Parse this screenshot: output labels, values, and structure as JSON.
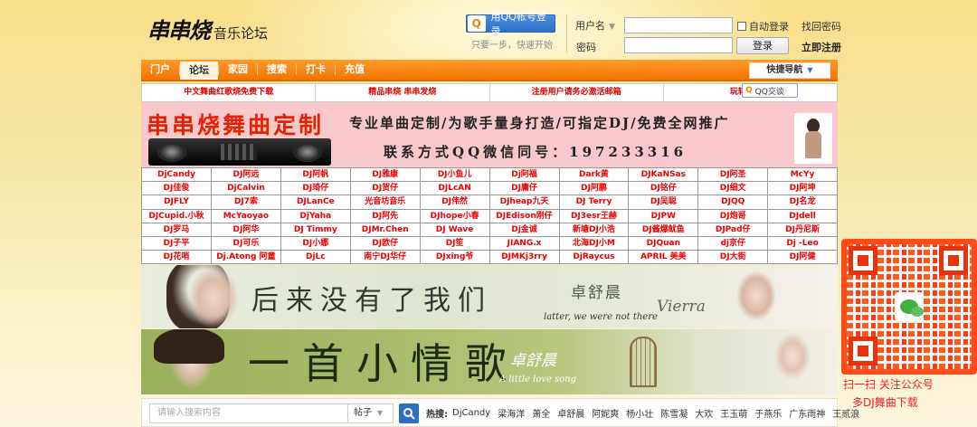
{
  "header": {
    "logo_main": "串串烧",
    "logo_sub": "音乐论坛",
    "qq_login_label": "用QQ帐号登录",
    "qq_hint": "只要一步，快速开始",
    "username_label": "用户名",
    "password_label": "密码",
    "auto_login_label": "自动登录",
    "find_password": "找回密码",
    "login_button": "登录",
    "register": "立即注册"
  },
  "nav": {
    "items": [
      "门户",
      "论坛",
      "家园",
      "搜索",
      "打卡",
      "充值"
    ],
    "active_index": 1,
    "quick_nav": "快捷导航"
  },
  "announcements": [
    "中文舞曲红歌烧免费下载",
    "精品串烧 串串发烧",
    "注册用户请务必激活邮箱",
    "玩转串串烧"
  ],
  "qq_chat": "QQ交谈",
  "banner": {
    "title": "串串烧舞曲定制",
    "line1": "专业单曲定制/为歌手量身打造/可指定DJ/免费全网推广",
    "line2": "联系方式QQ微信同号：197233316"
  },
  "dj_rows": [
    [
      "DjCandy",
      "DJ阿远",
      "DJ阿帆",
      "DJ雅康",
      "DJ小鱼儿",
      "Dj阿福",
      "Dark黄",
      "DJKaNSas",
      "DJ阿圣",
      "McYy"
    ],
    [
      "DJ佳俊",
      "DjCalvin",
      "DJ琦仔",
      "DJ贺仔",
      "DJLcAN",
      "DJ庸仔",
      "DJ阿鹏",
      "DJ铭仔",
      "DJ细文",
      "DJ阿坤"
    ],
    [
      "DJFLY",
      "DJ7索",
      "DJLanCe",
      "光音坊音乐",
      "DJ伟然",
      "DJheap九天",
      "DJ Terry",
      "DJ吴聪",
      "DJQQ",
      "DJ名龙"
    ],
    [
      "DJCupid.小秋",
      "McYaoyao",
      "DjYaha",
      "DJ阿先",
      "DJhope小春",
      "DJEdison刚仔",
      "DJ3esr王赫",
      "DJPW",
      "DJ炮哥",
      "DJdell"
    ],
    [
      "DJ罗马",
      "DJ阿华",
      "DJ Timmy",
      "DJMr.Chen",
      "DJ Wave",
      "Dj金诚",
      "新塘DJ小浩",
      "DJ酱爆鱿鱼",
      "DJPad仔",
      "DJ丹尼斯"
    ],
    [
      "DJ子平",
      "DJ可乐",
      "DJ小娜",
      "DJ欧仔",
      "DJ笙",
      "JIANG.x",
      "北海DJ小M",
      "DJQuan",
      "dj京仔",
      "Dj -Leo"
    ],
    [
      "DJ花哨",
      "Dj.Atong 阿童",
      "DjLc",
      "南宁DJ华仔",
      "DJxing爷",
      "DJMKj3rry",
      "DjRaycus",
      "APRIL 美美",
      "DJ大街",
      "DJ阿健"
    ]
  ],
  "song1": {
    "title": "后来没有了我们",
    "singer": "卓舒晨",
    "english": "latter, we were not there",
    "feat": "Vierra"
  },
  "song2": {
    "title": "一首小情歌",
    "singer": "卓舒晨",
    "english": "A little love song"
  },
  "search": {
    "placeholder": "请输入搜索内容",
    "type_selected": "帖子",
    "hot_label": "热搜:",
    "hot_items": [
      "DjCandy",
      "梁海洋",
      "萧全",
      "卓舒晨",
      "阿妮爽",
      "杨小壮",
      "陈雪凝",
      "大欢",
      "王玉萌",
      "于燕乐",
      "广东雨神",
      "王贰浪"
    ]
  },
  "qr": {
    "line1": "扫一扫 关注公众号",
    "line2": "多DJ舞曲下载"
  }
}
